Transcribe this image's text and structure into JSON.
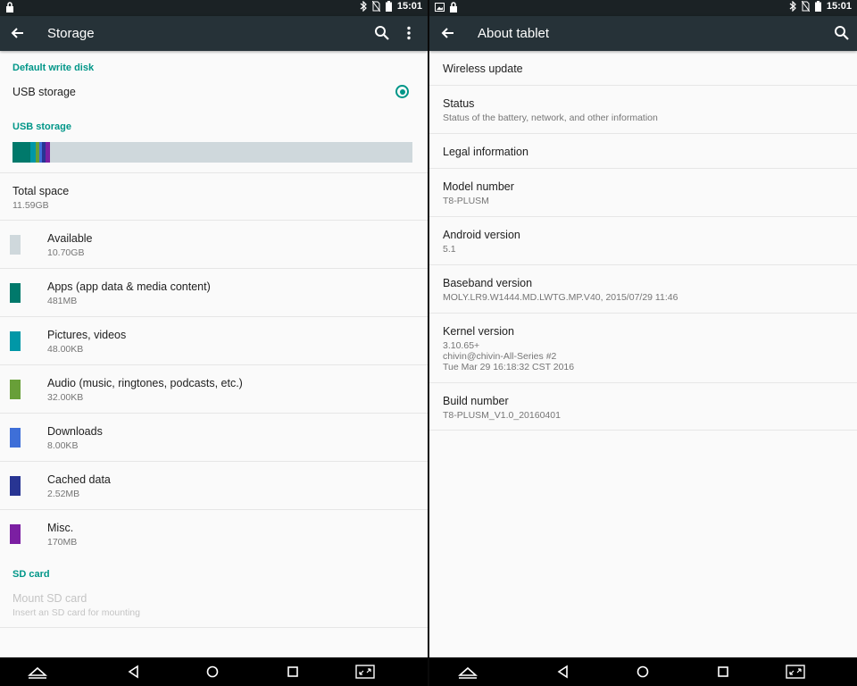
{
  "colors": {
    "accent": "#009688",
    "toolbar": "#263238",
    "statusbar": "#1b2225",
    "available": "#cfd8dc",
    "apps": "#00796b",
    "pictures": "#0097a7",
    "audio": "#689f38",
    "downloads": "#3e6fd8",
    "cached": "#283593",
    "misc": "#7b1fa2"
  },
  "status_bar": {
    "time": "15:01",
    "left_icons_left": [
      "lock-icon"
    ],
    "left_icons_right": [
      "image-icon",
      "lock-icon"
    ],
    "right_icons": [
      "bluetooth-icon",
      "no-sim-icon",
      "battery-icon"
    ]
  },
  "storage": {
    "title": "Storage",
    "default_write_disk": {
      "header": "Default write disk",
      "option": "USB storage",
      "selected": true
    },
    "usb_storage": {
      "header": "USB storage",
      "usage_bar_fraction_used": 0.077,
      "total_space": {
        "label": "Total space",
        "value": "11.59GB"
      },
      "items": [
        {
          "label": "Available",
          "value": "10.70GB",
          "color": "#cfd8dc"
        },
        {
          "label": "Apps (app data & media content)",
          "value": "481MB",
          "color": "#00796b"
        },
        {
          "label": "Pictures, videos",
          "value": "48.00KB",
          "color": "#0097a7"
        },
        {
          "label": "Audio (music, ringtones, podcasts, etc.)",
          "value": "32.00KB",
          "color": "#689f38"
        },
        {
          "label": "Downloads",
          "value": "8.00KB",
          "color": "#3e6fd8"
        },
        {
          "label": "Cached data",
          "value": "2.52MB",
          "color": "#283593"
        },
        {
          "label": "Misc.",
          "value": "170MB",
          "color": "#7b1fa2"
        }
      ]
    },
    "sd_card": {
      "header": "SD card",
      "mount": {
        "label": "Mount SD card",
        "summary": "Insert an SD card for mounting"
      }
    }
  },
  "about": {
    "title": "About tablet",
    "items": [
      {
        "label": "Wireless update"
      },
      {
        "label": "Status",
        "summary": "Status of the battery, network, and other information"
      },
      {
        "label": "Legal information"
      },
      {
        "label": "Model number",
        "summary": "T8-PLUSM"
      },
      {
        "label": "Android version",
        "summary": "5.1"
      },
      {
        "label": "Baseband version",
        "summary": "MOLY.LR9.W1444.MD.LWTG.MP.V40, 2015/07/29 11:46"
      },
      {
        "label": "Kernel version",
        "summary_lines": [
          "3.10.65+",
          "chivin@chivin-All-Series #2",
          "Tue Mar 29 16:18:32 CST 2016"
        ]
      },
      {
        "label": "Build number",
        "summary": "T8-PLUSM_V1.0_20160401"
      }
    ]
  }
}
